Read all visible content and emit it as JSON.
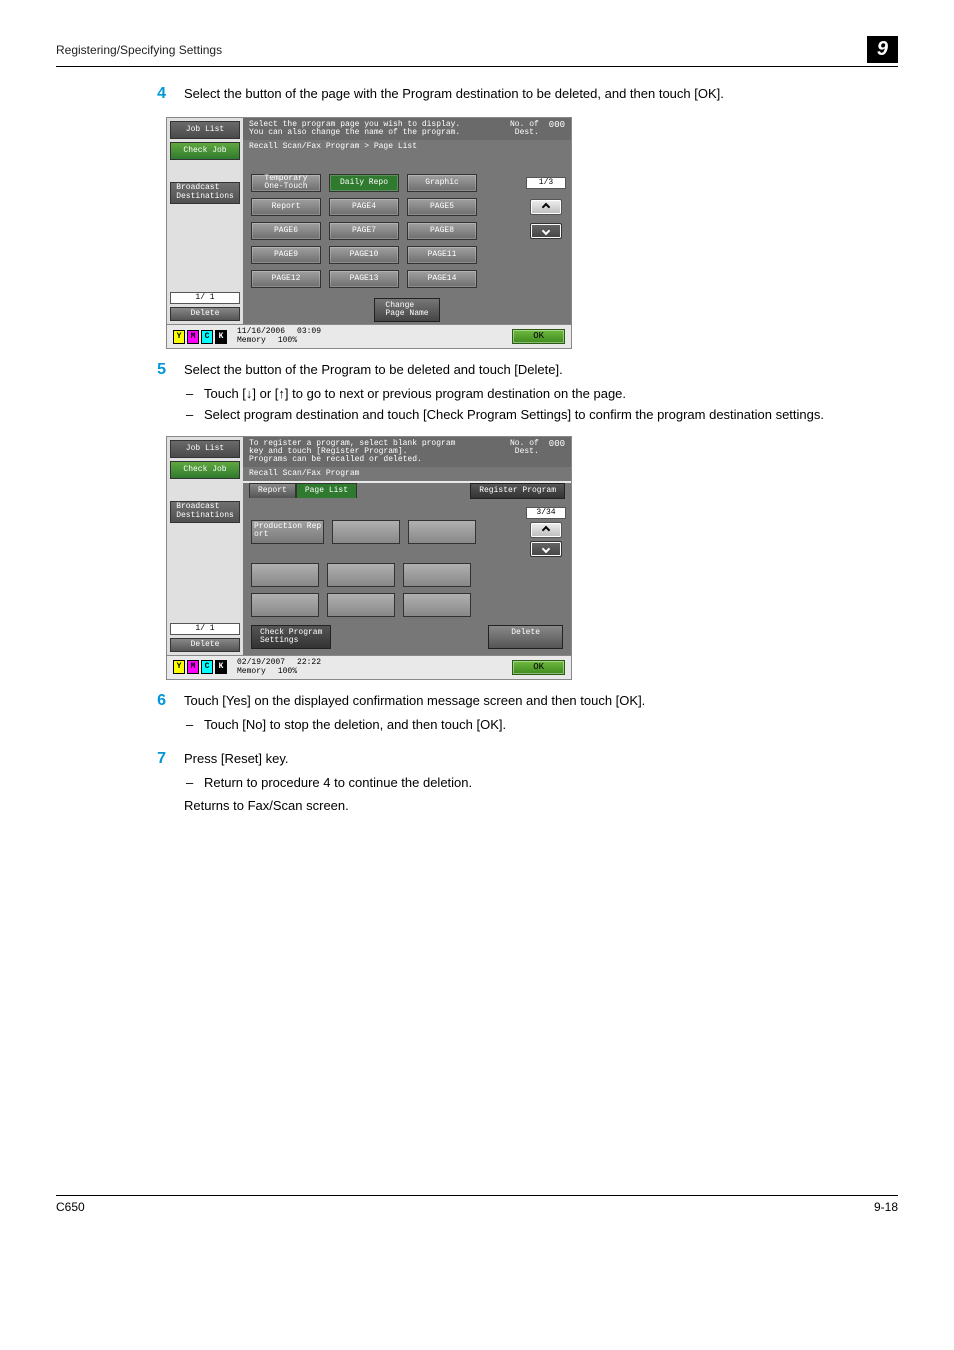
{
  "header": {
    "title": "Registering/Specifying Settings",
    "chapter_num": "9"
  },
  "steps": {
    "s4": {
      "num": "4",
      "text": "Select the button of the page with the Program destination to be deleted, and then touch [OK]."
    },
    "s5": {
      "num": "5",
      "text": "Select the button of the Program to be deleted and touch [Delete].",
      "b1": "Touch [↓] or [↑] to go to next or previous program destination on the page.",
      "b2": "Select program destination and touch [Check Program Settings] to confirm the program destination settings."
    },
    "s6": {
      "num": "6",
      "text": "Touch [Yes] on the displayed confirmation message screen and then touch [OK].",
      "b1": "Touch [No] to stop the deletion, and then touch [OK]."
    },
    "s7": {
      "num": "7",
      "text": "Press [Reset] key.",
      "b1": "Return to procedure 4 to continue the deletion.",
      "closing": "Returns to Fax/Scan screen."
    }
  },
  "screen1": {
    "msg": "Select the program page you wish to display.\nYou can also change the name of the program.",
    "count_label": "No. of\nDest.",
    "count_value": "000",
    "breadcrumb": "Recall Scan/Fax Program > Page List",
    "left": {
      "job": "Job List",
      "check": "Check Job",
      "broadcast": "Broadcast\nDestinations",
      "pager": "1/  1",
      "delete": "Delete"
    },
    "grid": {
      "r1c1": "Temporary\nOne-Touch",
      "r1c2": "Daily Repo",
      "r1c3": "Graphic",
      "r2c1": "Report",
      "r2c2": "PAGE4",
      "r2c3": "PAGE5",
      "r3c1": "PAGE6",
      "r3c2": "PAGE7",
      "r3c3": "PAGE8",
      "r4c1": "PAGE9",
      "r4c2": "PAGE10",
      "r4c3": "PAGE11",
      "r5c1": "PAGE12",
      "r5c2": "PAGE13",
      "r5c3": "PAGE14"
    },
    "pagenav": "1/3",
    "change_page": "Change\nPage Name",
    "status": {
      "date": "11/16/2006",
      "time": "03:09",
      "memory_label": "Memory",
      "memory_value": "100%",
      "ok": "OK"
    },
    "toner": {
      "y": "Y",
      "m": "M",
      "c": "C",
      "k": "K"
    }
  },
  "screen2": {
    "msg": "To register a program, select blank program\nkey and touch [Register Program].\nPrograms can be recalled or deleted.",
    "count_label": "No. of\nDest.",
    "count_value": "000",
    "breadcrumb": "Recall Scan/Fax Program",
    "left": {
      "job": "Job List",
      "check": "Check Job",
      "broadcast": "Broadcast\nDestinations",
      "pager": "1/  1",
      "delete": "Delete"
    },
    "tabs": {
      "report": "Report",
      "pagelist": "Page List",
      "register": "Register Program"
    },
    "slots": {
      "s1": "Production Rep\nort"
    },
    "pagenav": "3/34",
    "bottom": {
      "check": "Check Program\nSettings",
      "delete": "Delete"
    },
    "status": {
      "date": "02/19/2007",
      "time": "22:22",
      "memory_label": "Memory",
      "memory_value": "100%",
      "ok": "OK"
    },
    "toner": {
      "y": "Y",
      "m": "M",
      "c": "C",
      "k": "K"
    }
  },
  "footer": {
    "left": "C650",
    "right": "9-18"
  }
}
